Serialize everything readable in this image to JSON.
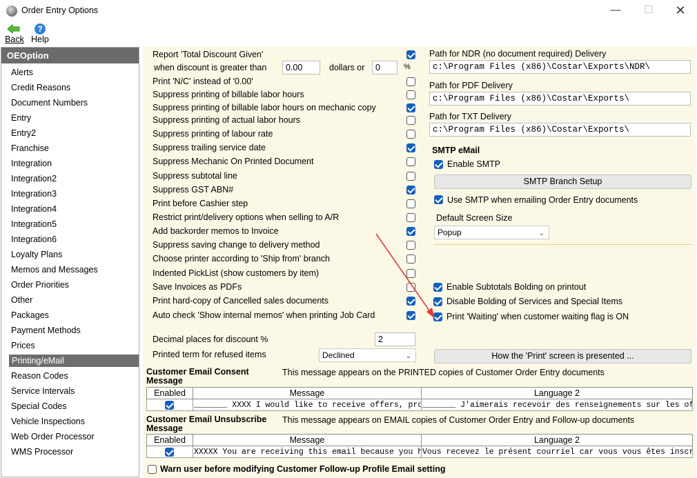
{
  "window": {
    "title": "Order Entry Options",
    "icons": [
      "app-icon",
      "minimize-icon",
      "maximize-icon",
      "close-icon"
    ]
  },
  "toolbar": {
    "back_label": "Back",
    "help_label": "Help"
  },
  "sidebar": {
    "header": "OEOption",
    "selected": "Printing/eMail",
    "items": [
      "Alerts",
      "Credit Reasons",
      "Document Numbers",
      "Entry",
      "Entry2",
      "Franchise",
      "Integration",
      "Integration2",
      "Integration3",
      "Integration4",
      "Integration5",
      "Integration6",
      "Loyalty Plans",
      "Memos and Messages",
      "Order Priorities",
      "Other",
      "Packages",
      "Payment Methods",
      "Prices",
      "Printing/eMail",
      "Reason Codes",
      "Service Intervals",
      "Special Codes",
      "Vehicle Inspections",
      "Web Order Processor",
      "WMS Processor"
    ]
  },
  "options_left": [
    {
      "label": "Report 'Total Discount Given'",
      "checked": true
    },
    {
      "label": "Print 'N/C' instead of '0.00'",
      "checked": false
    },
    {
      "label": "Suppress printing of billable labor hours",
      "checked": false
    },
    {
      "label": "Suppress printing of billable labor hours on mechanic copy",
      "checked": true
    },
    {
      "label": "Suppress printing of actual labor hours",
      "checked": false
    },
    {
      "label": "Suppress printing of labour rate",
      "checked": false
    },
    {
      "label": "Suppress trailing service date",
      "checked": true
    },
    {
      "label": "Suppress Mechanic On Printed Document",
      "checked": false
    },
    {
      "label": "Suppress subtotal line",
      "checked": false
    },
    {
      "label": "Suppress GST ABN#",
      "checked": true
    },
    {
      "label": "Print before Cashier step",
      "checked": false
    },
    {
      "label": "Restrict print/delivery options when selling to A/R",
      "checked": false
    },
    {
      "label": "Add backorder memos to Invoice",
      "checked": true
    },
    {
      "label": "Suppress saving change to delivery method",
      "checked": false
    },
    {
      "label": "Choose printer according to 'Ship from' branch",
      "checked": false
    },
    {
      "label": "Indented PickList (show customers by item)",
      "checked": false
    },
    {
      "label": "Save Invoices as PDFs",
      "checked": false
    },
    {
      "label": "Print hard-copy of Cancelled sales documents",
      "checked": true
    },
    {
      "label": "Auto check 'Show internal memos' when printing Job Card",
      "checked": true
    }
  ],
  "discount": {
    "label": "when discount is greater than",
    "amount": "0.00",
    "or_label": "dollars or",
    "percent": "0",
    "percent_sign": "%"
  },
  "decimal": {
    "label": "Decimal places for discount %",
    "value": "2"
  },
  "refused": {
    "label": "Printed term for refused items",
    "value": "Declined"
  },
  "paths": {
    "ndr_label": "Path for NDR (no document required) Delivery",
    "ndr_value": "c:\\Program Files (x86)\\Costar\\Exports\\NDR\\",
    "pdf_label": "Path for PDF  Delivery",
    "pdf_value": "c:\\Program Files (x86)\\Costar\\Exports\\",
    "txt_label": "Path for TXT Delivery",
    "txt_value": "c:\\Program Files (x86)\\Costar\\Exports\\"
  },
  "smtp": {
    "heading": "SMTP eMail",
    "enable_label": "Enable SMTP",
    "enable_checked": true,
    "branch_button": "SMTP Branch Setup",
    "use_label": "Use SMTP when emailing Order Entry documents",
    "use_checked": true,
    "screen_size_label": "Default Screen Size",
    "screen_size_value": "Popup"
  },
  "options_right": [
    {
      "label": "Enable Subtotals Bolding on printout",
      "checked": true
    },
    {
      "label": "Disable Bolding of Services and Special Items",
      "checked": true
    },
    {
      "label": "Print 'Waiting' when customer waiting flag is ON",
      "checked": true
    }
  ],
  "print_screen_button": "How the 'Print' screen is presented ...",
  "consent": {
    "heading": "Customer Email Consent Message",
    "note": "This message appears on the PRINTED copies of Customer Order Entry documents",
    "columns": [
      "Enabled",
      "Message",
      "Language 2"
    ],
    "row": {
      "enabled": true,
      "message": "_______ XXXX I would like to receive offers, promotions",
      "language2": "_______ J'aimerais recevoir des renseignements sur les offres, pro"
    }
  },
  "unsubscribe": {
    "heading": "Customer Email Unsubscribe Message",
    "note": "This message appears on EMAIL copies of Customer Order Entry and Follow-up documents",
    "columns": [
      "Enabled",
      "Message",
      "Language 2"
    ],
    "row": {
      "enabled": true,
      "message": "XXXXX You are receiving this email because you have su",
      "language2": "Vous recevez le présent courriel car vous vous êtes inscrit au progr"
    }
  },
  "warn": {
    "label": "Warn user before modifying Customer Follow-up Profile Email setting",
    "checked": false
  },
  "colors": {
    "panel_bg": "#fbf8e6",
    "accent": "#1560bd",
    "sidebar_header": "#6b6b6b",
    "annotation_arrow": "#e03a3a",
    "divider": "#e8d27a"
  }
}
